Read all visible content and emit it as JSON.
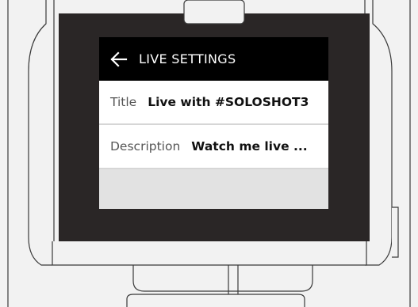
{
  "header": {
    "title": "LIVE SETTINGS",
    "back_icon": "arrow-left-icon"
  },
  "settings": [
    {
      "label": "Title",
      "value": "Live with #SOLOSHOT3"
    },
    {
      "label": "Description",
      "value": "Watch me live ..."
    }
  ],
  "colors": {
    "header_bg": "#000000",
    "bezel": "#2a2626",
    "row_bg": "#ffffff",
    "empty_area": "#e2e2e2"
  }
}
